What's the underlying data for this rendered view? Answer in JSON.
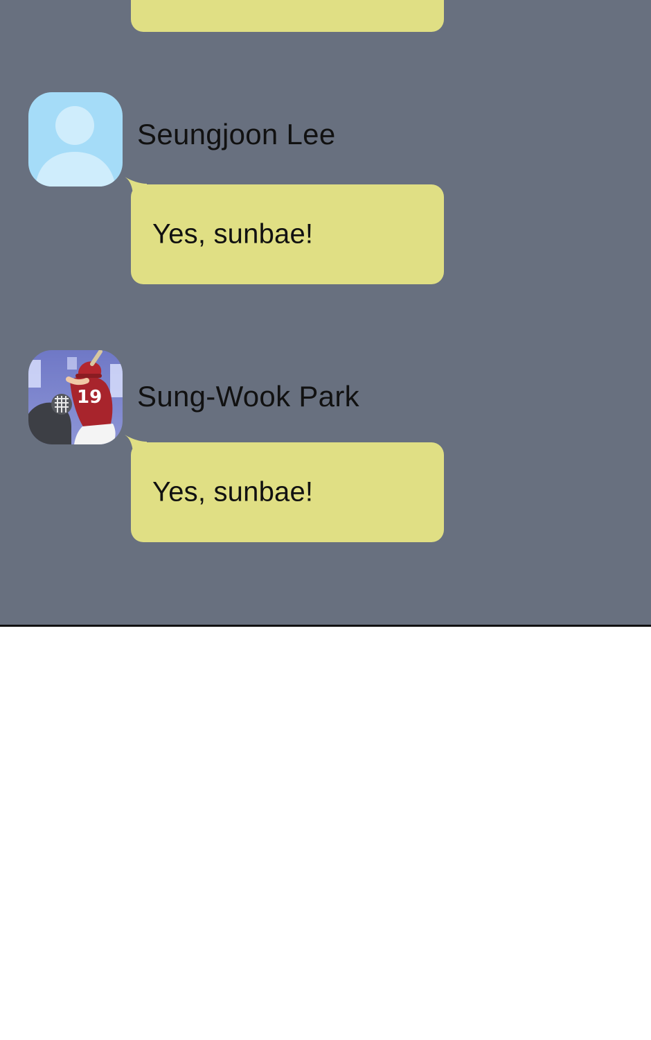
{
  "chat": {
    "messages": [
      {
        "sender": "Seungjoon Lee",
        "avatar_icon": "default-profile-icon",
        "text": "Yes, sunbae!"
      },
      {
        "sender": "Sung-Wook Park",
        "avatar_icon": "baseball-batter-profile-photo",
        "text": "Yes, sunbae!"
      }
    ]
  },
  "colors": {
    "chat_background": "#68707f",
    "bubble": "#e0df84",
    "default_avatar_background": "#a5dcf8",
    "default_avatar_figure": "#cfedfc",
    "page_background": "#ffffff"
  }
}
